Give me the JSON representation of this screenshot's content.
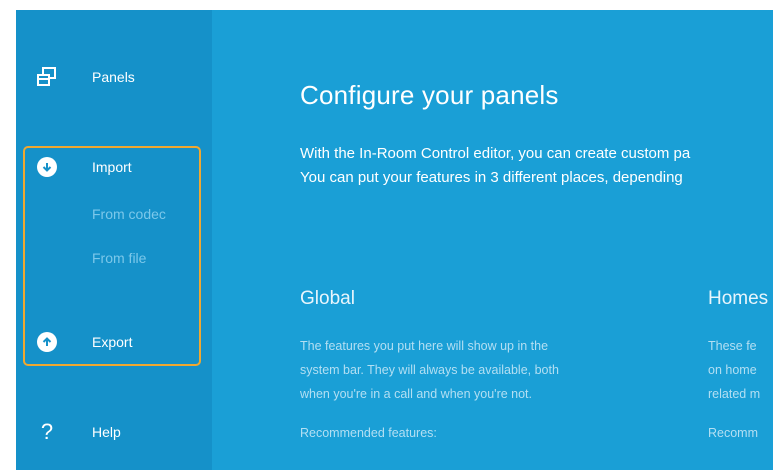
{
  "sidebar": {
    "panels_label": "Panels",
    "import_label": "Import",
    "from_codec_label": "From codec",
    "from_file_label": "From file",
    "export_label": "Export",
    "help_label": "Help",
    "help_glyph": "?"
  },
  "main": {
    "title": "Configure your panels",
    "intro_line1": "With the In-Room Control editor, you can create custom pa",
    "intro_line2": "You can put your features in 3 different places, depending",
    "columns": [
      {
        "title": "Global",
        "lines": [
          "The features you put here will show up in the",
          "system bar. They will always be available, both",
          "when you're in a call and when you're not."
        ],
        "recommended": "Recommended features:"
      },
      {
        "title": "Homes",
        "lines": [
          "These fe",
          "on home",
          "related m"
        ],
        "recommended": "Recomm"
      }
    ]
  },
  "colors": {
    "sidebar_bg": "#1591c9",
    "main_bg": "#1a9fd6",
    "highlight_border": "#f0a830",
    "sub_item_text": "#7cc8ea"
  },
  "icons": {
    "panels": "panels-icon",
    "import": "download-circle-icon",
    "export": "upload-circle-icon",
    "help": "question-mark-icon"
  }
}
